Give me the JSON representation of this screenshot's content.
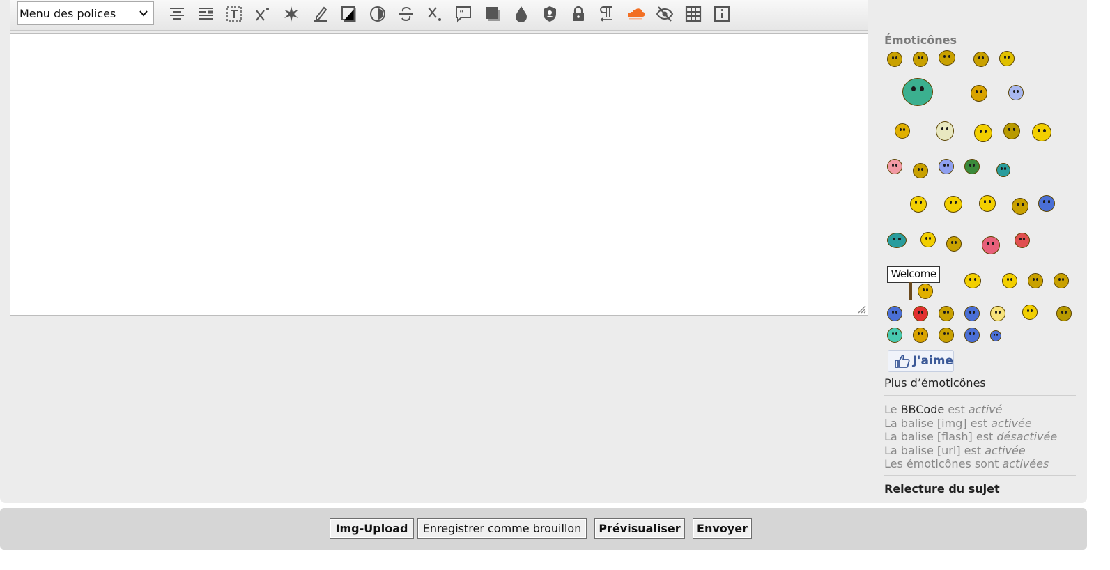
{
  "toolbar": {
    "font_menu": "Menu des polices",
    "icons": [
      "align-center-icon",
      "align-justify-icon",
      "text-box-icon",
      "superscript-icon",
      "sparkle-icon",
      "highlight-pen-icon",
      "border-box-icon",
      "contrast-icon",
      "strikethrough-icon",
      "subscript-icon",
      "quote-icon",
      "shadow-icon",
      "color-drop-icon",
      "user-shield-icon",
      "lock-icon",
      "paragraph-icon",
      "soundcloud-icon",
      "hide-eye-icon",
      "table-icon",
      "info-icon"
    ]
  },
  "sidebar": {
    "emoticons_title": "Émoticônes",
    "welcome_sign": "Welcome",
    "like_label": "J'aime",
    "more_emoticons": "Plus d’émoticônes",
    "rules": {
      "bbcode_prefix": "Le ",
      "bbcode_link": "BBCode",
      "bbcode_mid": " est ",
      "bbcode_state": "activé",
      "img_text": "La balise [img] est ",
      "img_state": "activée",
      "flash_text": "La balise [flash] est ",
      "flash_state": "désactivée",
      "url_text": "La balise [url] est ",
      "url_state": "activée",
      "emoticons_text": "Les émoticônes sont ",
      "emoticons_state": "activées"
    },
    "review_topic": "Relecture du sujet"
  },
  "buttons": {
    "img_upload": "Img-Upload",
    "save_draft": "Enregistrer comme brouillon",
    "preview": "Prévisualiser",
    "send": "Envoyer"
  },
  "colors": {
    "smiley_yellow": "#f2cf00",
    "smiley_olive": "#c9a100",
    "smiley_blue": "#4a6fd6",
    "smiley_red": "#e23030",
    "smiley_green": "#3b8a3b",
    "smiley_teal": "#2a9d9d",
    "smiley_pink": "#f29aa4",
    "facebook_blue": "#3b5998"
  }
}
